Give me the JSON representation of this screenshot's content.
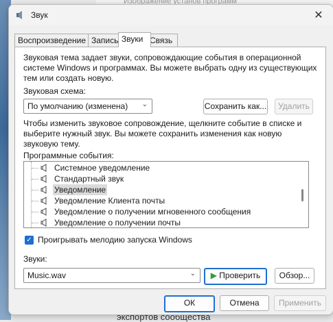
{
  "background": {
    "ghost_text": "Изображение установ программ",
    "bottom_text": "экспортов сообщества"
  },
  "window": {
    "title": "Звук",
    "close": "✕"
  },
  "tabs": [
    {
      "label": "Воспроизведение"
    },
    {
      "label": "Запись"
    },
    {
      "label": "Звуки"
    },
    {
      "label": "Связь"
    }
  ],
  "panel": {
    "intro_line1": "Звуковая тема задает звуки, сопровождающие события в операционной",
    "intro_line2": "системе Windows и программах. Вы можете выбрать одну из существующих",
    "intro_line3": "тем или создать новую.",
    "scheme_label": "Звуковая схема:",
    "scheme_value": "По умолчанию (изменена)",
    "save_as": "Сохранить как...",
    "delete": "Удалить",
    "hint_line1": "Чтобы изменить звуковое сопровождение, щелкните событие в списке и",
    "hint_line2": "выберите нужный звук. Вы можете сохранить изменения как новую",
    "hint_line3": "звуковую тему.",
    "events_label": "Программные события:",
    "events": [
      {
        "label": "Системное уведомление"
      },
      {
        "label": "Стандартный звук"
      },
      {
        "label": "Уведомление",
        "selected": true
      },
      {
        "label": "Уведомление Клиента почты"
      },
      {
        "label": "Уведомление о получении мгновенного сообщения"
      },
      {
        "label": "Уведомление о получении почты"
      }
    ],
    "startup_checkbox": "Проигрывать мелодию запуска Windows",
    "startup_checked": true,
    "sounds_label": "Звуки:",
    "sound_value": "Music.wav",
    "test": "Проверить",
    "browse": "Обзор..."
  },
  "footer": {
    "ok": "ОК",
    "cancel": "Отмена",
    "apply": "Применить"
  },
  "colors": {
    "accent": "#1f6fd0",
    "play": "#2ea02e"
  }
}
